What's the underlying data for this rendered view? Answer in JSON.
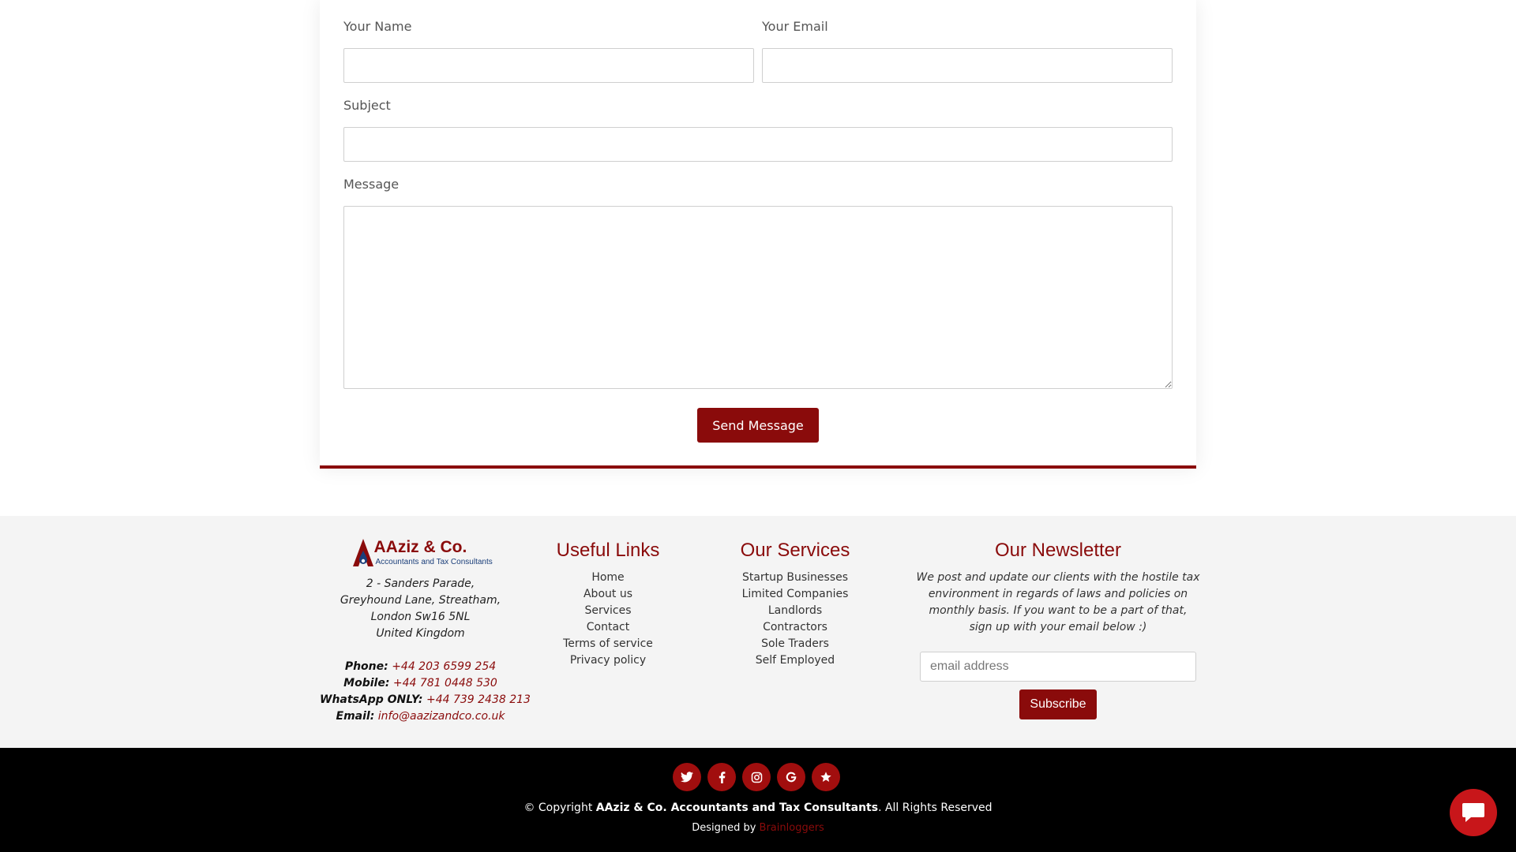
{
  "contact_form": {
    "name_label": "Your Name",
    "name_value": "",
    "email_label": "Your Email",
    "email_value": "",
    "subject_label": "Subject",
    "subject_value": "",
    "message_label": "Message",
    "message_value": "",
    "send_label": "Send Message"
  },
  "footer": {
    "logo": {
      "title": "AAziz & Co.",
      "subtitle": "Accountants and Tax Consultants"
    },
    "address": {
      "line1": "2 - Sanders Parade,",
      "line2": "Greyhound Lane, Streatham,",
      "line3": "London Sw16 5NL",
      "line4": "United Kingdom"
    },
    "contacts": {
      "phone_label": "Phone:",
      "phone_value": "+44 203 6599 254",
      "mobile_label": "Mobile:",
      "mobile_value": "+44 781 0448 530",
      "whatsapp_label": "WhatsApp ONLY:",
      "whatsapp_value": "+44 739 2438 213",
      "email_label": "Email:",
      "email_value": "info@aazizandco.co.uk"
    },
    "useful_links": {
      "heading": "Useful Links",
      "items": [
        "Home",
        "About us",
        "Services",
        "Contact",
        "Terms of service",
        "Privacy policy"
      ]
    },
    "our_services": {
      "heading": "Our Services",
      "items": [
        "Startup Businesses",
        "Limited Companies",
        "Landlords",
        "Contractors",
        "Sole Traders",
        "Self Employed"
      ]
    },
    "newsletter": {
      "heading": "Our Newsletter",
      "text": "We post and update our clients with the hostile tax environment in regards of laws and policies on monthly basis. If you want to be a part of that, sign up with your email below :)",
      "email_placeholder": "email address",
      "subscribe_label": "Subscribe"
    },
    "social_icons": [
      "twitter-icon",
      "facebook-icon",
      "instagram-icon",
      "google-icon",
      "star-icon"
    ],
    "copyright_prefix": "© Copyright",
    "copyright_company": "AAziz & Co. Accountants and Tax Consultants",
    "copyright_suffix": ". All Rights Reserved",
    "designed_by_prefix": "Designed by",
    "designed_by_name": "Brainloggers"
  },
  "chat_widget": {
    "icon": "chat-icon"
  },
  "colors": {
    "brand_red": "#8a0b0b",
    "social_red": "#a10e0e",
    "chat_red": "#c8161a",
    "footer_bg": "#f4f4f4",
    "bottom_bar_bg": "#000000"
  }
}
